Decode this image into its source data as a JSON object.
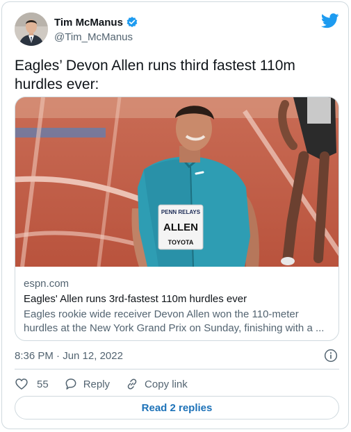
{
  "author": {
    "display_name": "Tim McManus",
    "handle": "@Tim_McManus",
    "verified": true,
    "avatar_icon": "user-photo"
  },
  "brand": {
    "logo_icon": "twitter-bird-icon",
    "color": "#1d9bf0"
  },
  "tweet": {
    "text": "Eagles’ Devon Allen runs third fastest 110m hurdles ever:"
  },
  "link_card": {
    "domain": "espn.com",
    "title": "Eagles' Allen runs 3rd-fastest 110m hurdles ever",
    "description": "Eagles rookie wide receiver Devon Allen won the 110-meter hurdles at the New York Grand Prix on Sunday, finishing with a ...",
    "image": {
      "bib_top": "PENN RELAYS",
      "bib_name": "ALLEN",
      "bib_sponsor": "TOYOTA"
    }
  },
  "meta": {
    "timestamp": "8:36 PM · Jun 12, 2022"
  },
  "actions": {
    "like_count": "55",
    "reply_label": "Reply",
    "copy_link_label": "Copy link"
  },
  "replies_button_label": "Read 2 replies",
  "colors": {
    "text": "#0f1419",
    "secondary": "#536471",
    "border": "#cfd9de",
    "link": "#1d72b8"
  }
}
